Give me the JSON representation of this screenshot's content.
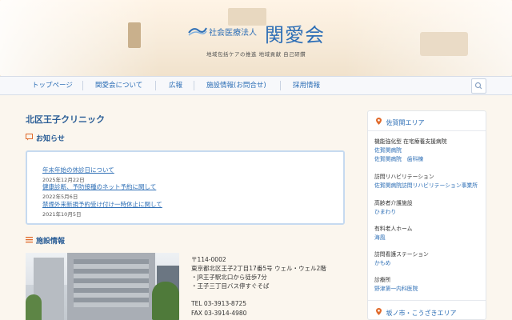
{
  "header": {
    "logo_sub": "社会医療法人",
    "logo_main": "関愛会",
    "tagline": "地域包括ケアの推進  地域貢献  自己研鑽"
  },
  "nav": {
    "items": [
      "トップページ",
      "関愛会について",
      "広報",
      "施設情報(お問合せ)",
      "採用情報"
    ]
  },
  "main": {
    "page_title": "北区王子クリニック",
    "news_heading": "お知らせ",
    "news": [
      {
        "title": "年末年始の休診日について",
        "date": "2025年12月22日"
      },
      {
        "title": "健康診断、予防接種のネット予約に関して",
        "date": "2022年5月6日"
      },
      {
        "title": "禁煙外来新規予約受け付け一時休止に関して",
        "date": "2021年10月5日"
      }
    ],
    "facility_heading": "施設情報",
    "address_lines": [
      "〒114-0002",
      "東京都北区王子2丁目17番5号 ウェル・ウェル2階",
      "・JR王子駅北口から徒歩7分",
      "・王子三丁目バス停すぐそば",
      "TEL 03-3913-8725",
      "FAX 03-3914-4980"
    ]
  },
  "sidebar": {
    "area1": "佐賀関エリア",
    "groups": [
      {
        "category": "機能強化型 在宅療養支援病院",
        "links": [
          "佐賀関病院",
          "佐賀関病院　歯科棟"
        ]
      },
      {
        "category": "訪問リハビリテーション",
        "links": [
          "佐賀関病院訪問リハビリテーション事業所"
        ]
      },
      {
        "category": "高齢者介護施設",
        "links": [
          "ひまわり"
        ]
      },
      {
        "category": "有料老人ホーム",
        "links": [
          "海風"
        ]
      },
      {
        "category": "訪問看護ステーション",
        "links": [
          "かもめ"
        ]
      },
      {
        "category": "診療所",
        "links": [
          "野津第一内科医院"
        ]
      }
    ],
    "area2": "坂ノ市・こうざきエリア"
  },
  "colors": {
    "brand_blue": "#2e6fb6",
    "accent_orange": "#e06a2b",
    "page_bg": "#fbf6ee"
  },
  "icons": {
    "search": "search-icon",
    "pin": "map-pin-icon",
    "news": "chat-bubble-icon",
    "facility": "list-icon"
  }
}
